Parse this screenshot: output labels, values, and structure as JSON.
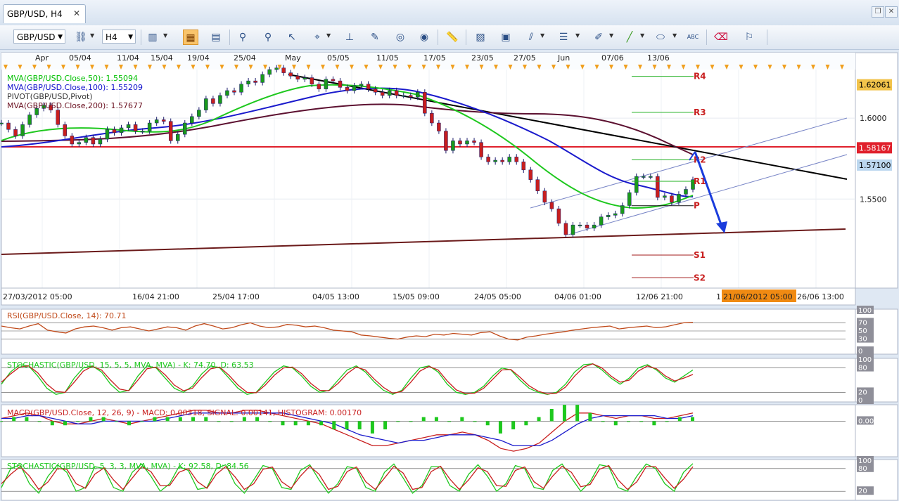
{
  "window": {
    "tab_title": "GBP/USD, H4",
    "close_glyph": "✕"
  },
  "toolbar": {
    "symbol": "GBP/USD",
    "timeframe": "H4",
    "icons": [
      "link-icon",
      "bar-chart-icon",
      "candlestick-icon",
      "line-chart-icon",
      "zoom-in-icon",
      "zoom-out-icon",
      "cursor-icon",
      "crosshair-icon",
      "pin-icon",
      "edit-icon",
      "eye-icon",
      "globe-icon",
      "ruler-icon",
      "picture-icon",
      "template-icon",
      "fibonacci-icon",
      "channel-icon",
      "pen-icon",
      "line-tool-icon",
      "ellipse-icon",
      "text-icon",
      "eraser-icon",
      "tree-icon"
    ]
  },
  "chart_data": [
    {
      "type": "line",
      "name": "price",
      "legend": [
        {
          "text": "MVA(GBP/USD.Close,50): 1.55094",
          "color": "#00c000"
        },
        {
          "text": "MVA(GBP/USD.Close,100): 1.55209",
          "color": "#1010cc"
        },
        {
          "text": "PIVOT(GBP/USD,Pivot)",
          "color": "#333333"
        },
        {
          "text": "MVA(GBP/USD.Close,200): 1.57677",
          "color": "#6a1020"
        }
      ],
      "top_dates": [
        "Apr",
        "05/04",
        "11/04",
        "15/04",
        "19/04",
        "25/04",
        "May",
        "05/05",
        "11/05",
        "17/05",
        "23/05",
        "27/05",
        "Jun",
        "07/06",
        "13/06"
      ],
      "bottom_dates": [
        "27/03/2012 05:00",
        "16/04 21:00",
        "25/04 17:00",
        "04/05 13:00",
        "15/05 09:00",
        "24/05 05:00",
        "04/06 01:00",
        "12/06 21:00",
        "1",
        "21/06/2012 05:00",
        "26/06 13:00"
      ],
      "y_ticks": [
        "1.6000",
        "1.5500"
      ],
      "ylim": [
        1.495,
        1.63
      ],
      "price_labels": [
        {
          "text": "1.62061",
          "value": 1.62061,
          "bg": "#f2c34b"
        },
        {
          "text": "1.58167",
          "value": 1.58167,
          "bg": "#e0202c"
        },
        {
          "text": "1.57100",
          "value": 1.571,
          "bg": "#bcd7ef"
        }
      ],
      "pivot_levels": [
        {
          "name": "R4",
          "value": 1.6258
        },
        {
          "name": "R3",
          "value": 1.6036
        },
        {
          "name": "R2",
          "value": 1.5742
        },
        {
          "name": "R1",
          "value": 1.561
        },
        {
          "name": "P",
          "value": 1.5459
        },
        {
          "name": "S1",
          "value": 1.5154
        },
        {
          "name": "S2",
          "value": 1.5014
        }
      ],
      "series": [
        {
          "name": "GBP/USD",
          "x": [
            0,
            10,
            20,
            30,
            40,
            50,
            60,
            70,
            80,
            90,
            100,
            110,
            120,
            130,
            140,
            150,
            160,
            170,
            180,
            190,
            200,
            210,
            220,
            230,
            240,
            250,
            260,
            270,
            280,
            290,
            300,
            310,
            320,
            330,
            340,
            350,
            360,
            370,
            380,
            390,
            400,
            410,
            420,
            430,
            440,
            450,
            460,
            470,
            480,
            490,
            500,
            510,
            520,
            530,
            540,
            550,
            560,
            570,
            580,
            590,
            600,
            610,
            620,
            630,
            640,
            650,
            660,
            670,
            680,
            690,
            700,
            710,
            720,
            730,
            740,
            750,
            760,
            770,
            780,
            790,
            800,
            810,
            820,
            830,
            840,
            850,
            860,
            870,
            880,
            890,
            900,
            910,
            920,
            930,
            940,
            950,
            960,
            970,
            980
          ],
          "y": [
            1.597,
            1.593,
            1.589,
            1.596,
            1.602,
            1.606,
            1.608,
            1.605,
            1.596,
            1.589,
            1.584,
            1.585,
            1.588,
            1.584,
            1.587,
            1.593,
            1.591,
            1.594,
            1.596,
            1.592,
            1.592,
            1.597,
            1.599,
            1.598,
            1.586,
            1.59,
            1.597,
            1.601,
            1.605,
            1.612,
            1.609,
            1.614,
            1.617,
            1.616,
            1.621,
            1.623,
            1.622,
            1.627,
            1.63,
            1.631,
            1.628,
            1.626,
            1.624,
            1.625,
            1.621,
            1.618,
            1.624,
            1.623,
            1.619,
            1.617,
            1.62,
            1.621,
            1.618,
            1.616,
            1.614,
            1.617,
            1.614,
            1.614,
            1.613,
            1.616,
            1.603,
            1.597,
            1.592,
            1.58,
            1.586,
            1.584,
            1.586,
            1.585,
            1.576,
            1.573,
            1.574,
            1.573,
            1.576,
            1.573,
            1.568,
            1.562,
            1.555,
            1.548,
            1.544,
            1.535,
            1.528,
            1.534,
            1.534,
            1.532,
            1.534,
            1.539,
            1.54,
            1.541,
            1.546,
            1.554,
            1.564,
            1.564,
            1.564,
            1.551,
            1.552,
            1.548,
            1.553,
            1.556,
            1.562
          ]
        }
      ],
      "annotations": [
        "R4",
        "R3",
        "R2",
        "R1",
        "P",
        "S1",
        "S2"
      ]
    },
    {
      "type": "line",
      "name": "rsi",
      "title": "RSI(GBP/USD.Close, 14): 70.71",
      "y_ticks": [
        "100",
        "70",
        "50",
        "30",
        "0"
      ],
      "ylim": [
        0,
        100
      ],
      "series": [
        {
          "name": "RSI",
          "y": [
            62,
            58,
            55,
            62,
            68,
            52,
            48,
            45,
            55,
            60,
            62,
            58,
            52,
            58,
            60,
            55,
            50,
            55,
            60,
            58,
            52,
            62,
            68,
            62,
            55,
            58,
            65,
            70,
            62,
            58,
            60,
            66,
            64,
            60,
            62,
            58,
            52,
            50,
            48,
            40,
            38,
            35,
            32,
            30,
            35,
            38,
            36,
            42,
            40,
            44,
            42,
            40,
            46,
            48,
            38,
            30,
            28,
            35,
            38,
            42,
            45,
            48,
            52,
            55,
            58,
            60,
            62,
            55,
            58,
            60,
            62,
            58,
            60,
            65,
            70,
            71
          ]
        }
      ]
    },
    {
      "type": "line",
      "name": "stochastic-15",
      "title": "STOCHASTIC(GBP/USD, 15, 5, 5, MVA, MVA) - K: 74.70, D: 63.53",
      "y_ticks": [
        "100",
        "80",
        "20",
        "0"
      ],
      "ylim": [
        0,
        100
      ],
      "series": [
        {
          "name": "K",
          "y": [
            40,
            70,
            88,
            85,
            60,
            30,
            15,
            20,
            55,
            80,
            85,
            70,
            40,
            20,
            25,
            60,
            85,
            80,
            55,
            30,
            20,
            35,
            65,
            85,
            80,
            55,
            30,
            15,
            20,
            45,
            70,
            85,
            80,
            60,
            35,
            20,
            25,
            50,
            75,
            85,
            70,
            45,
            25,
            15,
            25,
            55,
            80,
            85,
            70,
            40,
            20,
            15,
            20,
            35,
            60,
            80,
            75,
            50,
            30,
            20,
            15,
            20,
            40,
            70,
            88,
            90,
            75,
            55,
            40,
            55,
            80,
            88,
            75,
            55,
            45,
            60,
            75
          ]
        },
        {
          "name": "D",
          "y": [
            45,
            65,
            82,
            85,
            68,
            40,
            22,
            20,
            45,
            72,
            84,
            75,
            50,
            28,
            24,
            50,
            78,
            82,
            63,
            38,
            24,
            30,
            56,
            78,
            82,
            62,
            38,
            20,
            19,
            38,
            62,
            80,
            82,
            66,
            42,
            25,
            24,
            42,
            66,
            82,
            75,
            52,
            32,
            18,
            22,
            45,
            72,
            84,
            75,
            48,
            26,
            17,
            18,
            30,
            52,
            75,
            76,
            57,
            36,
            23,
            16,
            18,
            33,
            60,
            82,
            90,
            80,
            60,
            45,
            50,
            72,
            85,
            78,
            60,
            48,
            55,
            64
          ]
        }
      ]
    },
    {
      "type": "line",
      "name": "macd",
      "title": "MACD(GBP/USD.Close, 12, 26, 9) - MACD: 0.00318, SIGNAL: 0.00141, HISTOGRAM: 0.00170",
      "y_ticks": [
        "0.00000"
      ],
      "ylim": [
        -0.012,
        0.005
      ],
      "series": [
        {
          "name": "MACD",
          "y": [
            0.001,
            0.002,
            0.003,
            0.002,
            0.0,
            -0.001,
            -0.001,
            0.0,
            0.001,
            0.0,
            -0.001,
            0.0,
            0.001,
            0.002,
            0.003,
            0.004,
            0.004,
            0.003,
            0.003,
            0.004,
            0.004,
            0.003,
            0.002,
            0.001,
            0.0,
            -0.001,
            -0.003,
            -0.005,
            -0.007,
            -0.009,
            -0.009,
            -0.008,
            -0.007,
            -0.006,
            -0.005,
            -0.005,
            -0.004,
            -0.005,
            -0.007,
            -0.01,
            -0.011,
            -0.01,
            -0.008,
            -0.004,
            0.0,
            0.003,
            0.003,
            0.002,
            0.001,
            0.002,
            0.002,
            0.001,
            0.001,
            0.002,
            0.003
          ]
        },
        {
          "name": "SIGNAL",
          "y": [
            0.001,
            0.001,
            0.002,
            0.002,
            0.001,
            0.0,
            -0.001,
            -0.001,
            0.0,
            0.0,
            0.0,
            0.0,
            0.0,
            0.001,
            0.002,
            0.003,
            0.003,
            0.003,
            0.003,
            0.003,
            0.003,
            0.003,
            0.003,
            0.002,
            0.001,
            0.0,
            -0.001,
            -0.003,
            -0.005,
            -0.006,
            -0.007,
            -0.008,
            -0.007,
            -0.007,
            -0.006,
            -0.005,
            -0.005,
            -0.005,
            -0.006,
            -0.007,
            -0.009,
            -0.009,
            -0.009,
            -0.007,
            -0.004,
            -0.001,
            0.001,
            0.002,
            0.002,
            0.002,
            0.002,
            0.002,
            0.001,
            0.001,
            0.002
          ]
        }
      ]
    },
    {
      "type": "line",
      "name": "stochastic-5",
      "title": "STOCHASTIC(GBP/USD, 5, 3, 3, MVA, MVA) - K: 92.58, D: 84.56",
      "y_ticks": [
        "100",
        "80",
        "20"
      ],
      "ylim": [
        0,
        100
      ],
      "series": [
        {
          "name": "K",
          "y": [
            30,
            80,
            90,
            40,
            15,
            60,
            90,
            70,
            20,
            30,
            85,
            80,
            30,
            20,
            70,
            92,
            60,
            20,
            40,
            85,
            75,
            25,
            30,
            80,
            90,
            40,
            15,
            50,
            88,
            80,
            30,
            25,
            75,
            90,
            50,
            15,
            40,
            85,
            80,
            30,
            20,
            70,
            92,
            55,
            15,
            35,
            85,
            85,
            35,
            20,
            65,
            90,
            60,
            20,
            40,
            88,
            80,
            30,
            25,
            75,
            92,
            55,
            20,
            45,
            90,
            85,
            30,
            20,
            60,
            92,
            80,
            40,
            20,
            70,
            93
          ]
        },
        {
          "name": "D",
          "y": [
            40,
            65,
            85,
            60,
            25,
            45,
            80,
            78,
            40,
            28,
            65,
            82,
            50,
            25,
            55,
            85,
            72,
            35,
            35,
            70,
            80,
            45,
            28,
            65,
            85,
            58,
            25,
            40,
            78,
            84,
            45,
            28,
            60,
            86,
            65,
            25,
            33,
            72,
            84,
            45,
            25,
            55,
            86,
            68,
            25,
            30,
            72,
            86,
            52,
            25,
            50,
            82,
            72,
            35,
            33,
            75,
            84,
            45,
            28,
            60,
            86,
            70,
            32,
            38,
            78,
            88,
            50,
            25,
            45,
            85,
            85,
            55,
            28,
            52,
            85
          ]
        }
      ]
    }
  ]
}
